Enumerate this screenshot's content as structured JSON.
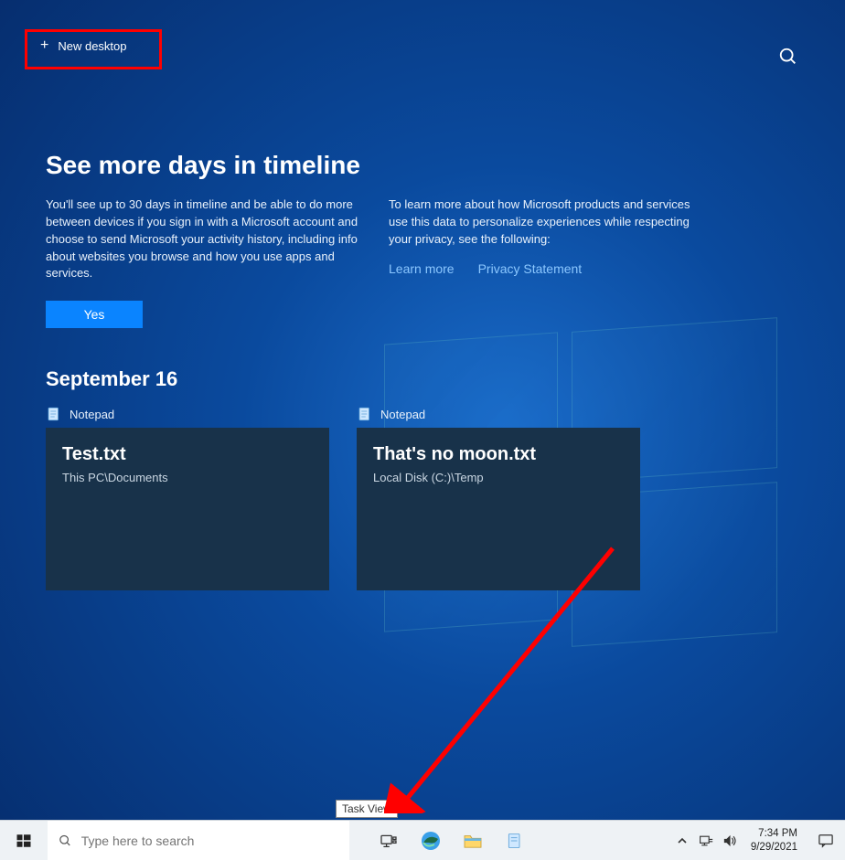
{
  "top": {
    "new_desktop_label": "New desktop"
  },
  "promo": {
    "heading": "See more days in timeline",
    "col1": "You'll see up to 30 days in timeline and be able to do more between devices if you sign in with a Microsoft account and choose to send Microsoft your activity history, including info about websites you browse and how you use apps and services.",
    "col2": "To learn more about how Microsoft products and services use this data to personalize experiences while respecting your privacy, see the following:",
    "learn_more": "Learn more",
    "privacy": "Privacy Statement",
    "yes": "Yes"
  },
  "timeline": {
    "date": "September 16",
    "cards": [
      {
        "app": "Notepad",
        "title": "Test.txt",
        "sub": "This PC\\Documents"
      },
      {
        "app": "Notepad",
        "title": "That's no moon.txt",
        "sub": "Local Disk (C:)\\Temp"
      }
    ]
  },
  "tooltip": "Task View",
  "taskbar": {
    "search_placeholder": "Type here to search",
    "time": "7:34 PM",
    "date": "9/29/2021"
  }
}
